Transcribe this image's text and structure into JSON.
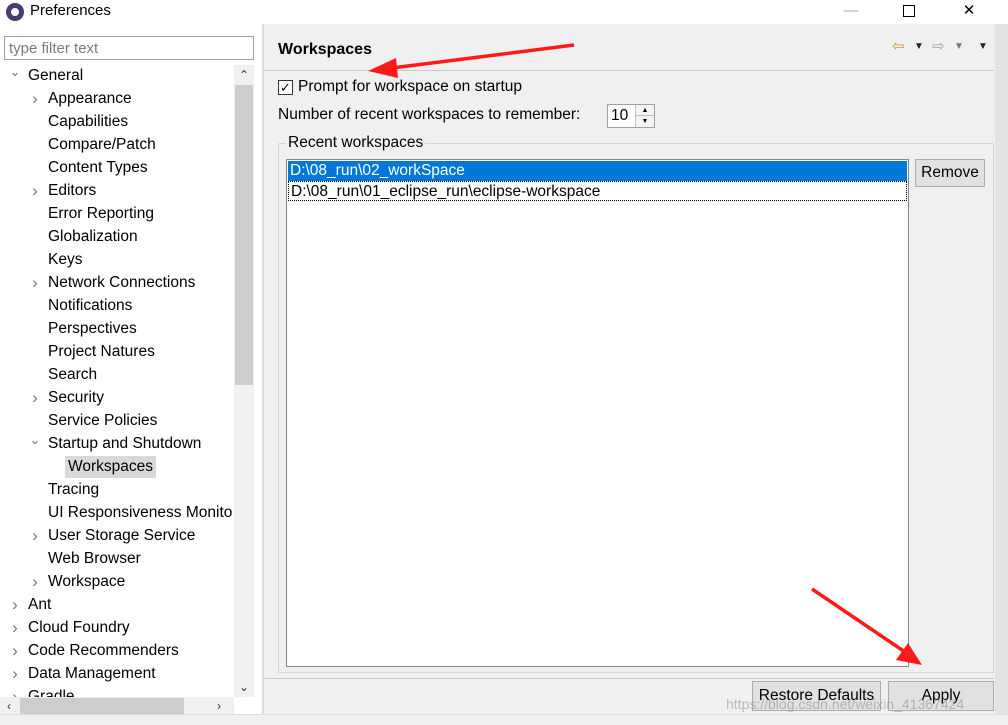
{
  "window": {
    "title": "Preferences",
    "minimize": "—",
    "close": "✕"
  },
  "filter": {
    "placeholder": "type filter text"
  },
  "tree": {
    "items": [
      {
        "label": "General",
        "expander": "expanded"
      },
      {
        "label": "Appearance",
        "expander": "collapsed"
      },
      {
        "label": "Capabilities",
        "expander": "none"
      },
      {
        "label": "Compare/Patch",
        "expander": "none"
      },
      {
        "label": "Content Types",
        "expander": "none"
      },
      {
        "label": "Editors",
        "expander": "collapsed"
      },
      {
        "label": "Error Reporting",
        "expander": "none"
      },
      {
        "label": "Globalization",
        "expander": "none"
      },
      {
        "label": "Keys",
        "expander": "none"
      },
      {
        "label": "Network Connections",
        "expander": "collapsed"
      },
      {
        "label": "Notifications",
        "expander": "none"
      },
      {
        "label": "Perspectives",
        "expander": "none"
      },
      {
        "label": "Project Natures",
        "expander": "none"
      },
      {
        "label": "Search",
        "expander": "none"
      },
      {
        "label": "Security",
        "expander": "collapsed"
      },
      {
        "label": "Service Policies",
        "expander": "none"
      },
      {
        "label": "Startup and Shutdown",
        "expander": "expanded"
      },
      {
        "label": "Workspaces",
        "expander": "none",
        "selected": true
      },
      {
        "label": "Tracing",
        "expander": "none"
      },
      {
        "label": "UI Responsiveness Monito",
        "expander": "none"
      },
      {
        "label": "User Storage Service",
        "expander": "collapsed"
      },
      {
        "label": "Web Browser",
        "expander": "none"
      },
      {
        "label": "Workspace",
        "expander": "collapsed"
      },
      {
        "label": "Ant",
        "expander": "collapsed"
      },
      {
        "label": "Cloud Foundry",
        "expander": "collapsed"
      },
      {
        "label": "Code Recommenders",
        "expander": "collapsed"
      },
      {
        "label": "Data Management",
        "expander": "collapsed"
      },
      {
        "label": "Gradle",
        "expander": "collapsed"
      }
    ]
  },
  "page": {
    "title": "Workspaces",
    "prompt_checkbox": {
      "label": "Prompt for workspace on startup",
      "checked": true
    },
    "recent_count": {
      "label": "Number of recent workspaces to remember:",
      "value": "10"
    },
    "recent_group_label": "Recent workspaces",
    "recent_workspaces": [
      {
        "path": "D:\\08_run\\02_workSpace",
        "selected": true
      },
      {
        "path": "D:\\08_run\\01_eclipse_run\\eclipse-workspace",
        "selected": false
      }
    ],
    "remove_label": "Remove",
    "restore_defaults_label": "Restore Defaults",
    "apply_label": "Apply"
  },
  "watermark": "https://blog.csdn.net/weixin_41367424",
  "colors": {
    "selection": "#0078d7",
    "annotation_arrow": "#ff1a1a",
    "tree_selection": "#d9d9d9"
  }
}
